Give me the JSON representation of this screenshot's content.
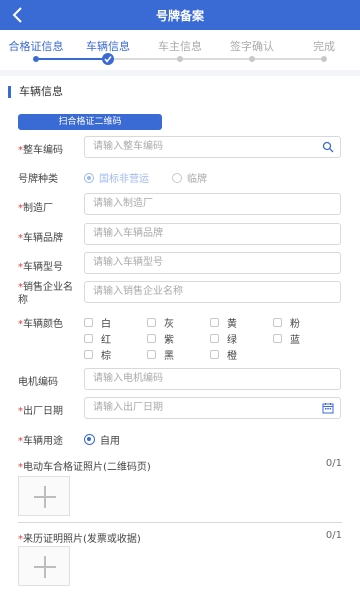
{
  "header": {
    "title": "号牌备案"
  },
  "steps": [
    {
      "label": "合格证信息",
      "state": "done"
    },
    {
      "label": "车辆信息",
      "state": "current"
    },
    {
      "label": "车主信息",
      "state": "todo"
    },
    {
      "label": "签字确认",
      "state": "todo"
    },
    {
      "label": "完成",
      "state": "todo"
    }
  ],
  "section": {
    "title": "车辆信息"
  },
  "scan_button": "扫合格证二维码",
  "fields": {
    "vin": {
      "label": "整车编码",
      "placeholder": "请输入整车编码"
    },
    "plate_type": {
      "label": "号牌种类",
      "option1": "国标非营运",
      "option2": "临牌"
    },
    "maker": {
      "label": "制造厂",
      "placeholder": "请输入制造厂"
    },
    "brand": {
      "label": "车辆品牌",
      "placeholder": "请输入车辆品牌"
    },
    "model": {
      "label": "车辆型号",
      "placeholder": "请输入车辆型号"
    },
    "seller": {
      "label": "销售企业名称",
      "placeholder": "请输入销售企业名称"
    },
    "color": {
      "label": "车辆颜色",
      "options": [
        "白",
        "灰",
        "黄",
        "粉",
        "红",
        "紫",
        "绿",
        "蓝",
        "棕",
        "黑",
        "橙"
      ]
    },
    "motor": {
      "label": "电机编码",
      "placeholder": "请输入电机编码"
    },
    "date": {
      "label": "出厂日期",
      "placeholder": "请输入出厂日期"
    },
    "usage": {
      "label": "车辆用途",
      "option": "自用"
    }
  },
  "uploads": [
    {
      "title": "电动车合格证照片(二维码页)",
      "count": "0/1"
    },
    {
      "title": "来历证明照片(发票或收据)",
      "count": "0/1"
    }
  ],
  "colors": {
    "primary": "#3a6ad4",
    "required": "#e53935"
  }
}
